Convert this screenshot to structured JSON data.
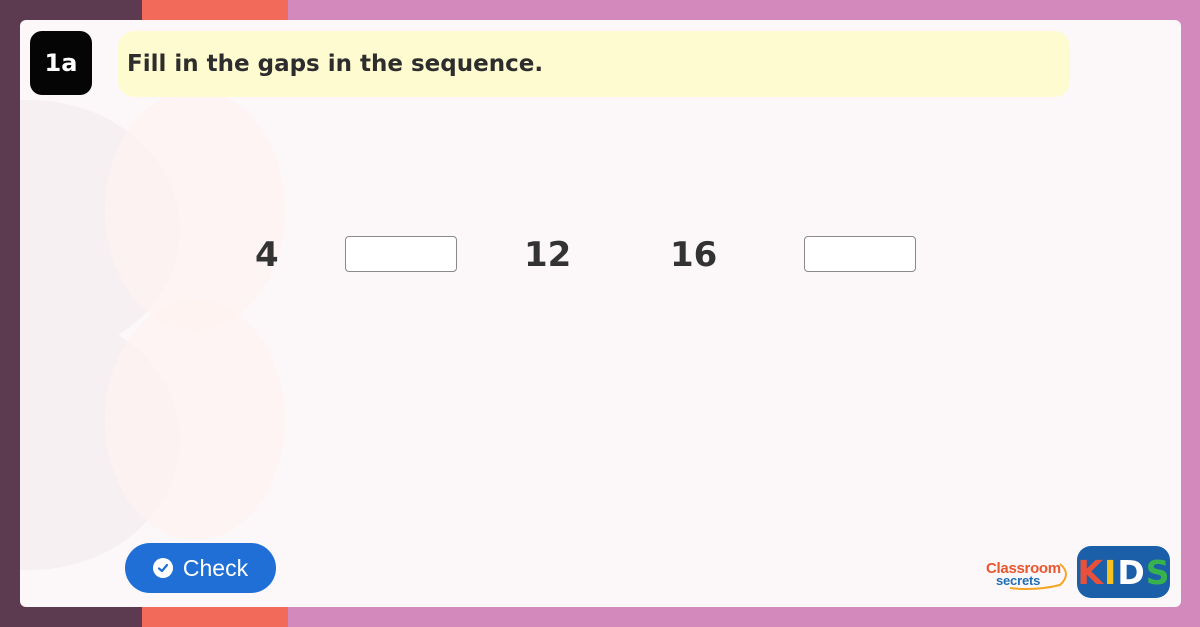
{
  "question": {
    "badge": "1a",
    "instruction": "Fill in the gaps in the sequence."
  },
  "sequence": {
    "items": [
      {
        "type": "number",
        "value": "4"
      },
      {
        "type": "blank",
        "value": ""
      },
      {
        "type": "number",
        "value": "12"
      },
      {
        "type": "number",
        "value": "16"
      },
      {
        "type": "blank",
        "value": ""
      }
    ]
  },
  "check_button": {
    "label": "Check",
    "icon": "check-circle-icon"
  },
  "branding": {
    "classroom_secrets_line1": "Classroom",
    "classroom_secrets_line2": "secrets",
    "kids_letters": [
      "K",
      "I",
      "D",
      "S"
    ],
    "kids_colors": [
      "#e8503a",
      "#f5c21b",
      "#ffffff",
      "#37b24d"
    ]
  },
  "colors": {
    "badge_bg": "#050505",
    "banner_bg": "#fffbd0",
    "check_button_bg": "#1f6fd6",
    "kids_logo_bg": "#1a5fa8"
  }
}
